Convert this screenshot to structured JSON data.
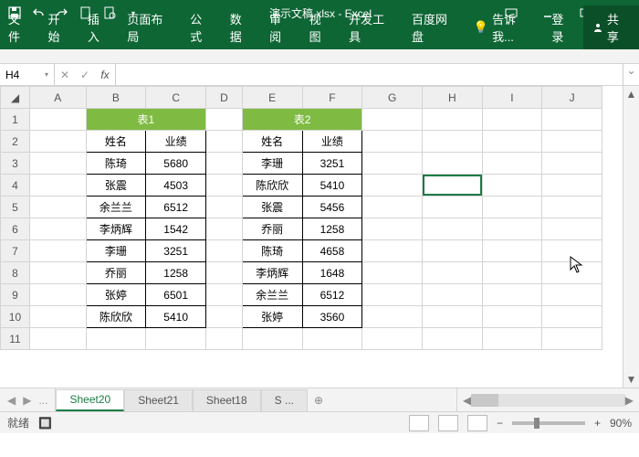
{
  "app": {
    "title": "演示文稿.xlsx - Excel"
  },
  "ribbon": {
    "tabs": [
      "文件",
      "开始",
      "插入",
      "页面布局",
      "公式",
      "数据",
      "审阅",
      "视图",
      "开发工具",
      "百度网盘"
    ],
    "tell_icon": "💡",
    "tell": "告诉我...",
    "login": "登录",
    "share": "共享"
  },
  "namebox": {
    "value": "H4"
  },
  "fx": {
    "down": "▾",
    "cancel": "✕",
    "confirm": "✓",
    "label": "fx"
  },
  "columns": [
    "A",
    "B",
    "C",
    "D",
    "E",
    "F",
    "G",
    "H",
    "I",
    "J"
  ],
  "table1": {
    "title": "表1",
    "h_name": "姓名",
    "h_val": "业绩",
    "rows": [
      {
        "n": "陈琦",
        "v": "5680"
      },
      {
        "n": "张震",
        "v": "4503"
      },
      {
        "n": "余兰兰",
        "v": "6512"
      },
      {
        "n": "李炳辉",
        "v": "1542"
      },
      {
        "n": "李珊",
        "v": "3251"
      },
      {
        "n": "乔丽",
        "v": "1258"
      },
      {
        "n": "张婷",
        "v": "6501"
      },
      {
        "n": "陈欣欣",
        "v": "5410"
      }
    ]
  },
  "table2": {
    "title": "表2",
    "h_name": "姓名",
    "h_val": "业绩",
    "rows": [
      {
        "n": "李珊",
        "v": "3251"
      },
      {
        "n": "陈欣欣",
        "v": "5410"
      },
      {
        "n": "张震",
        "v": "5456"
      },
      {
        "n": "乔丽",
        "v": "1258"
      },
      {
        "n": "陈琦",
        "v": "4658"
      },
      {
        "n": "李炳辉",
        "v": "1648"
      },
      {
        "n": "余兰兰",
        "v": "6512"
      },
      {
        "n": "张婷",
        "v": "3560"
      }
    ]
  },
  "sheets": {
    "s1": "Sheet20",
    "s2": "Sheet21",
    "s3": "Sheet18",
    "s4": "S ..."
  },
  "status": {
    "ready": "就绪",
    "rec": "🔲",
    "zoom": "90%"
  },
  "zoom_ctrl": {
    "minus": "−",
    "plus": "+"
  },
  "active_cell": "H4",
  "rownums": [
    "1",
    "2",
    "3",
    "4",
    "5",
    "6",
    "7",
    "8",
    "9",
    "10",
    "11"
  ]
}
